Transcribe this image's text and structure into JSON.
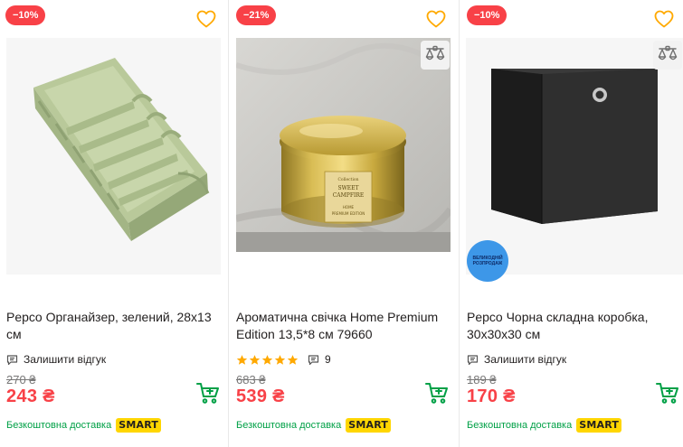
{
  "products": [
    {
      "discount": "−10%",
      "title": "Pepco Органайзер, зелений, 28x13 см",
      "review_label": "Залишити відгук",
      "old_price": "270 ₴",
      "price": "243 ₴",
      "delivery": "Безкоштовна доставка",
      "smart_label": "SMART"
    },
    {
      "discount": "−21%",
      "title": "Ароматична свічка Home Premium Edition 13,5*8 см 79660",
      "rating_stars": 5,
      "review_count": "9",
      "old_price": "683 ₴",
      "price": "539 ₴",
      "delivery": "Безкоштовна доставка",
      "smart_label": "SMART"
    },
    {
      "discount": "−10%",
      "title": "Pepco Чорна складна коробка, 30x30x30 см",
      "review_label": "Залишити відгук",
      "old_price": "189 ₴",
      "price": "170 ₴",
      "delivery": "Безкоштовна доставка",
      "smart_label": "SMART",
      "sale_badge": "ВЕЛИКОДНІЙ РОЗПРОДАЖ"
    }
  ],
  "colors": {
    "accent_red": "#f84147",
    "green": "#00a046",
    "star": "#ffa900",
    "smart_yellow": "#ffd600",
    "heart": "#ffa900"
  },
  "candle_label": [
    "Collection",
    "SWEET",
    "CAMPFIRE",
    "HOME",
    "PREMIUM EDITION"
  ]
}
